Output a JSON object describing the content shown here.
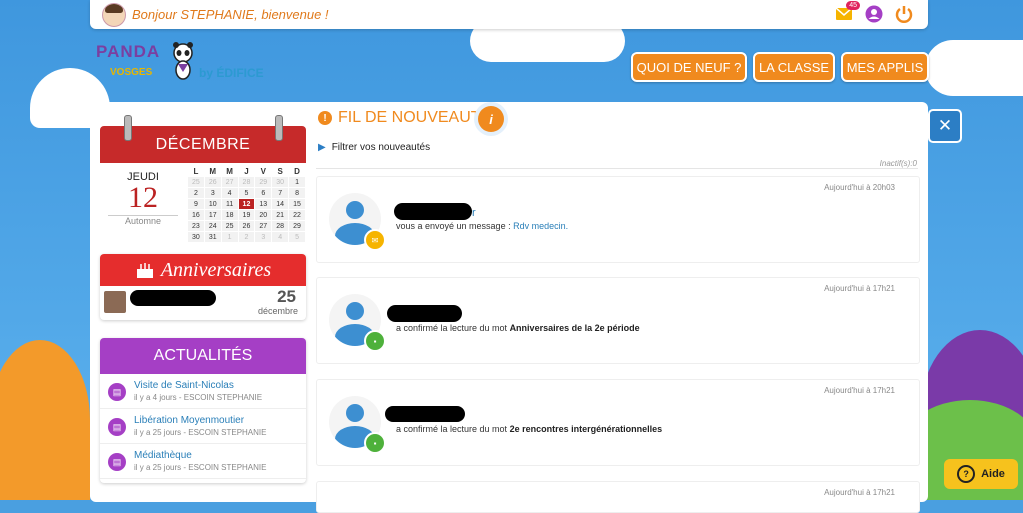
{
  "topbar": {
    "greeting": "Bonjour STEPHANIE, bienvenue !",
    "messages_badge": "45",
    "icons": [
      "mail-icon",
      "user-icon",
      "power-icon"
    ]
  },
  "logo": {
    "panda": "PANDA",
    "vosges": "VOSGES",
    "by": "by ÉDIFICE"
  },
  "nav": {
    "quoi_de_neuf": "QUOI DE NEUF ?",
    "la_classe": "LA CLASSE",
    "mes_applis": "MES APPLIS"
  },
  "calendar": {
    "month": "DÉCEMBRE",
    "weekday": "JEUDI",
    "day": "12",
    "season": "Automne",
    "headers": [
      "L",
      "M",
      "M",
      "J",
      "V",
      "S",
      "D"
    ],
    "weeks": [
      [
        [
          "25",
          "o"
        ],
        [
          "26",
          "o"
        ],
        [
          "27",
          "o"
        ],
        [
          "28",
          "o"
        ],
        [
          "29",
          "o"
        ],
        [
          "30",
          "o"
        ],
        [
          "1",
          ""
        ]
      ],
      [
        [
          "2",
          ""
        ],
        [
          "3",
          ""
        ],
        [
          "4",
          ""
        ],
        [
          "5",
          ""
        ],
        [
          "6",
          ""
        ],
        [
          "7",
          ""
        ],
        [
          "8",
          ""
        ]
      ],
      [
        [
          "9",
          ""
        ],
        [
          "10",
          ""
        ],
        [
          "11",
          ""
        ],
        [
          "12",
          "t"
        ],
        [
          "13",
          ""
        ],
        [
          "14",
          ""
        ],
        [
          "15",
          ""
        ]
      ],
      [
        [
          "16",
          ""
        ],
        [
          "17",
          ""
        ],
        [
          "18",
          ""
        ],
        [
          "19",
          ""
        ],
        [
          "20",
          ""
        ],
        [
          "21",
          ""
        ],
        [
          "22",
          ""
        ]
      ],
      [
        [
          "23",
          ""
        ],
        [
          "24",
          ""
        ],
        [
          "25",
          ""
        ],
        [
          "26",
          ""
        ],
        [
          "27",
          ""
        ],
        [
          "28",
          ""
        ],
        [
          "29",
          ""
        ]
      ],
      [
        [
          "30",
          ""
        ],
        [
          "31",
          ""
        ],
        [
          "1",
          "o"
        ],
        [
          "2",
          "o"
        ],
        [
          "3",
          "o"
        ],
        [
          "4",
          "o"
        ],
        [
          "5",
          "o"
        ]
      ]
    ]
  },
  "anniversaires": {
    "title": "Anniversaires",
    "day": "25",
    "month": "décembre"
  },
  "actualites": {
    "title": "ACTUALITÉS",
    "items": [
      {
        "title": "Visite de Saint-Nicolas",
        "meta": "il y a 4 jours - ESCOIN STEPHANIE"
      },
      {
        "title": "Libération Moyenmoutier",
        "meta": "il y a 25 jours - ESCOIN STEPHANIE"
      },
      {
        "title": "Médiathèque",
        "meta": "il y a 25 jours - ESCOIN STEPHANIE"
      }
    ]
  },
  "feed": {
    "title": "FIL DE NOUVEAUTÉS",
    "info": "i",
    "filter": "Filtrer vos nouveautés",
    "inactive": "Inactif(s):0",
    "cards": [
      {
        "time": "Aujourd'hui à 20h03",
        "name_tail": "r",
        "text": "vous a envoyé un message : ",
        "link": "Rdv medecin.",
        "bold": ""
      },
      {
        "time": "Aujourd'hui à 17h21",
        "name_tail": "",
        "text": "a confirmé la lecture du mot ",
        "link": "",
        "bold": "Anniversaires de la 2e période"
      },
      {
        "time": "Aujourd'hui à 17h21",
        "name_tail": "",
        "text": "a confirmé la lecture du mot ",
        "link": "",
        "bold": "2e rencontres intergénérationnelles"
      },
      {
        "time": "Aujourd'hui à 17h21",
        "name_tail": "",
        "text": "",
        "link": "",
        "bold": ""
      }
    ]
  },
  "aide": {
    "label": "Aide"
  },
  "colors": {
    "orange": "#f08a1e",
    "red": "#c62a2a",
    "purple": "#a53fc5",
    "blue": "#2c7ec5"
  }
}
